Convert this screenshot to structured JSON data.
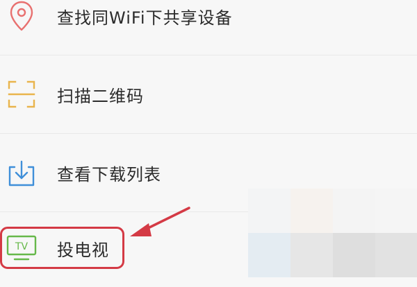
{
  "menu": {
    "items": [
      {
        "label": "查找同WiFi下共享设备",
        "icon": "location-pin-icon",
        "color": "#e8706f"
      },
      {
        "label": "扫描二维码",
        "icon": "scan-qr-icon",
        "color": "#e9b44c"
      },
      {
        "label": "查看下载列表",
        "icon": "download-tray-icon",
        "color": "#3f8fd9"
      },
      {
        "label": "投电视",
        "icon": "tv-cast-icon",
        "icon_text": "TV",
        "color": "#66b84a"
      }
    ]
  },
  "annotation": {
    "color": "#d43a45",
    "target": "投电视"
  },
  "colors": {
    "background": "#f7f7f7",
    "divider": "#e9e9e9",
    "text": "#2b2b2b"
  }
}
